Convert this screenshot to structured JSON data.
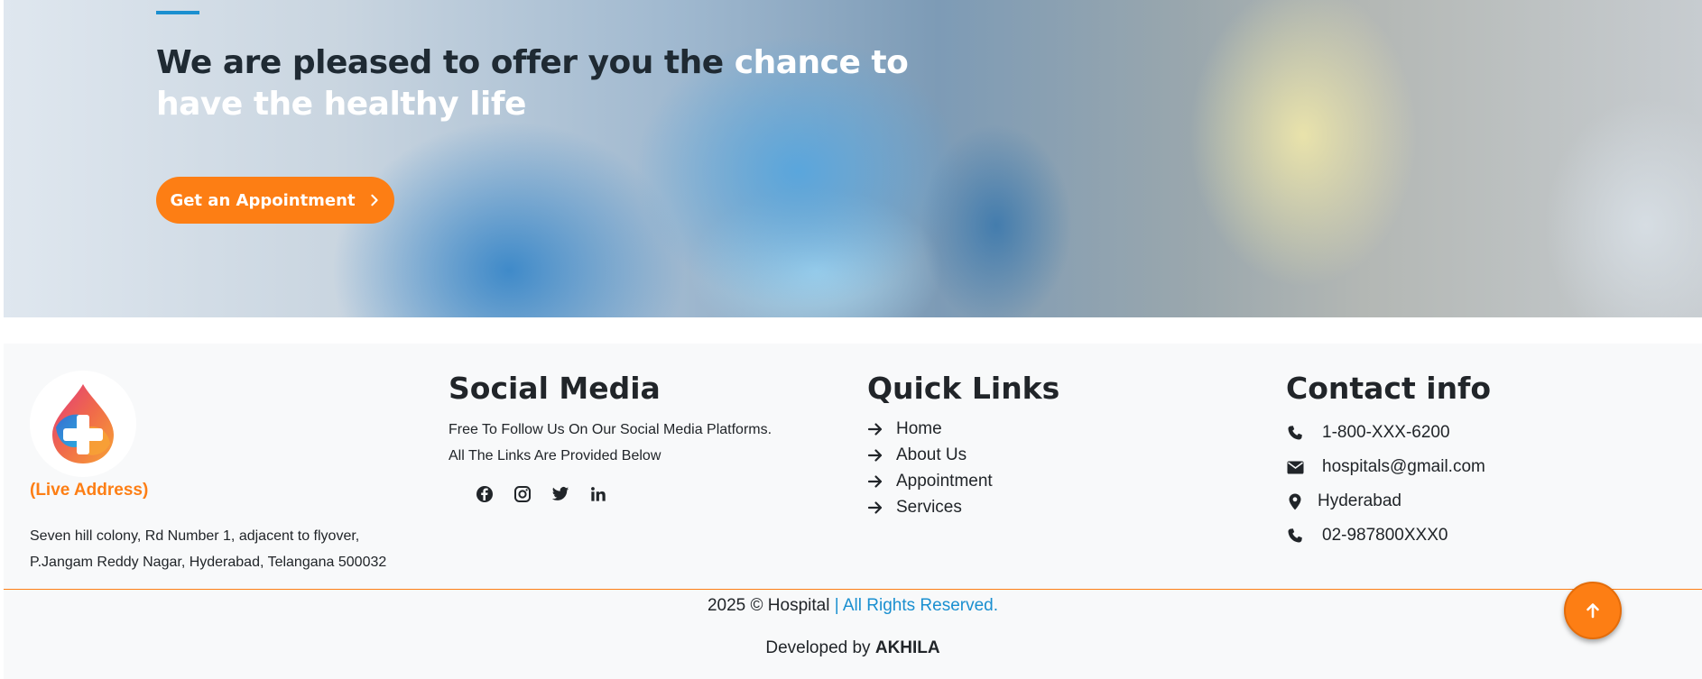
{
  "hero": {
    "title_dark": "We are pleased to offer you the",
    "title_light": "chance to have the healthy life",
    "cta_label": "Get an Appointment"
  },
  "footer": {
    "brand": {
      "live_address_label": "(Live Address)",
      "address_line1": "Seven hill colony, Rd Number 1, adjacent to flyover,",
      "address_line2": "P.Jangam Reddy Nagar, Hyderabad, Telangana 500032"
    },
    "social": {
      "title": "Social Media",
      "desc_line1": "Free To Follow Us On Our Social Media Platforms.",
      "desc_line2": "All The Links Are Provided Below",
      "icons": [
        "facebook-icon",
        "instagram-icon",
        "twitter-icon",
        "linkedin-icon"
      ]
    },
    "quick_links": {
      "title": "Quick Links",
      "items": [
        "Home",
        "About Us",
        "Appointment",
        "Services"
      ]
    },
    "contact": {
      "title": "Contact info",
      "items": [
        {
          "icon": "phone-icon",
          "text": "1-800-XXX-6200"
        },
        {
          "icon": "envelope-icon",
          "text": "hospitals@gmail.com"
        },
        {
          "icon": "map-pin-icon",
          "text": "Hyderabad"
        },
        {
          "icon": "phone-icon",
          "text": "02-987800XXX0"
        }
      ]
    },
    "copyright_main": "2025 © Hospital",
    "copyright_rights": "| All Rights Reserved.",
    "developed_by_label": "Developed by",
    "developer_name": "AKHILA"
  },
  "colors": {
    "accent_orange": "#fd7e14",
    "accent_blue": "#1a8fd0",
    "footer_bg": "#f8f9fa"
  }
}
